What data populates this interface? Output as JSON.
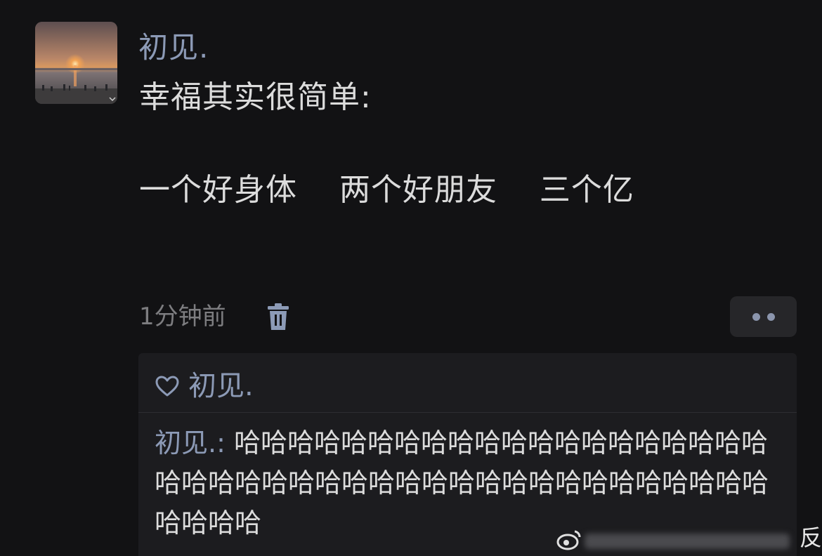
{
  "post": {
    "username": "初见.",
    "text_line1": "幸福其实很简单:",
    "text_line2": "一个好身体    两个好朋友    三个亿",
    "time": "1分钟前"
  },
  "likes": {
    "name": "初见."
  },
  "comment": {
    "author": "初见.",
    "separator": ": ",
    "text": "哈哈哈哈哈哈哈哈哈哈哈哈哈哈哈哈哈哈哈哈哈哈哈哈哈哈哈哈哈哈哈哈哈哈哈哈哈哈哈哈哈哈哈哈哈哈哈"
  },
  "watermark": {
    "trailing_char": "反"
  },
  "icons": {
    "trash": "trash-icon",
    "heart": "heart-icon",
    "more": "more-dots-icon",
    "weibo": "weibo-logo-icon"
  },
  "colors": {
    "background": "#121214",
    "name_accent": "#8c9ab6",
    "text": "#dcdcdc",
    "muted": "#7d7d80",
    "panel": "#1c1c1f"
  }
}
